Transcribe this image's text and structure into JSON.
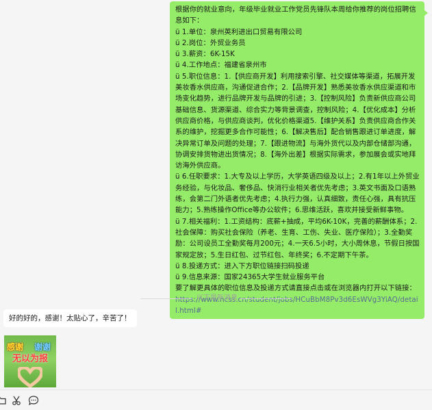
{
  "chat": {
    "sent_message": {
      "lines": [
        "根据你的就业意向，年级毕业就业工作党员先锋队本周给你推荐的岗位招聘信息如下：",
        "ü 1.单位：泉州英利进出口贸易有限公司",
        "ü 2.岗位：外贸业务员",
        "ü 3.薪资：6K-15K",
        "ü 4.工作地点：福建省泉州市",
        "ü 5.职位信息：1.【供应商开发】利用搜索引擎、社交媒体等渠道，拓展开发美妆香水供应商，沟通促进合作；2.【品牌开发】熟悉美妆香水供应渠道和市场变化趋势，进行品牌开发与品牌的引进；3.【控制风险】负责新供应商公司基础信息、货源渠道、综合实力等背景调查，控制风险；4.【优化成本】分析供应商价格，与供应商谈判，优化价格渠道5.【维护关系】负责供应商合作关系的维护，挖掘更多合作可能性；6.【解决售后】配合销售跟进订单进度，解决异常订单及问题的处理；7.【跟进物流】与海外货代以及内部仓储部沟通，协调安排货物进出货情况；8.【海外出差】根据实际需求，参加展会或实地拜访海外供应商。",
        "ü 6.任职要求：1.大专及以上学历，大学英语四级及以上；2.有1年以上外贸业务经验，与化妆品、奢侈品、快消行业相关者优先考虑；3.英文书面及口语熟练，会第二门外语者优先考虑；4.执行力强，认真细致，责任心强，具有抗压能力；5.熟练操作Office等办公软件；6.思维活跃，喜欢并接受新鲜事物。",
        "ü 7.相关福利：1.工资结构：底薪+抽成，平均6K-10K，完善的薪酬体系；2.社会保障：购买社会保险（养老、生育、工伤、失业、医疗保险）；3.全勤奖励：公司设员工全勤奖每月200元；4.一天6.5小时，大小周休息，节假日按国家规定放；5.生日红包、过节红包、年终奖；6.不定期下午茶。",
        "ü 8.投递方式：进入下方职位链接扫码投递",
        "ü 9.信息来源：国家24365大学生就业服务平台",
        "要了解更具体的职位信息及投递方式请直接点击或在浏览器内打开以下链接："
      ],
      "link": "https://www.ncss.cn/student/jobs/HCuBbM8Pv3d6EsWVg3YiAQ/detail.html#"
    },
    "divider_text": "以下是新消息",
    "received_message": "好的好的，感谢！太贴心了，辛苦了！",
    "sticker": {
      "text_1": "感谢",
      "text_2": "谢谢",
      "text_3": "无以为报"
    }
  },
  "toolbar": {
    "icons": [
      "folder-icon",
      "scissors-icon",
      "chat-bubble-icon"
    ]
  },
  "colors": {
    "sent_bubble": "#95ec69",
    "received_bubble": "#ffffff",
    "link": "#576b95",
    "background": "#f5f5f5"
  }
}
